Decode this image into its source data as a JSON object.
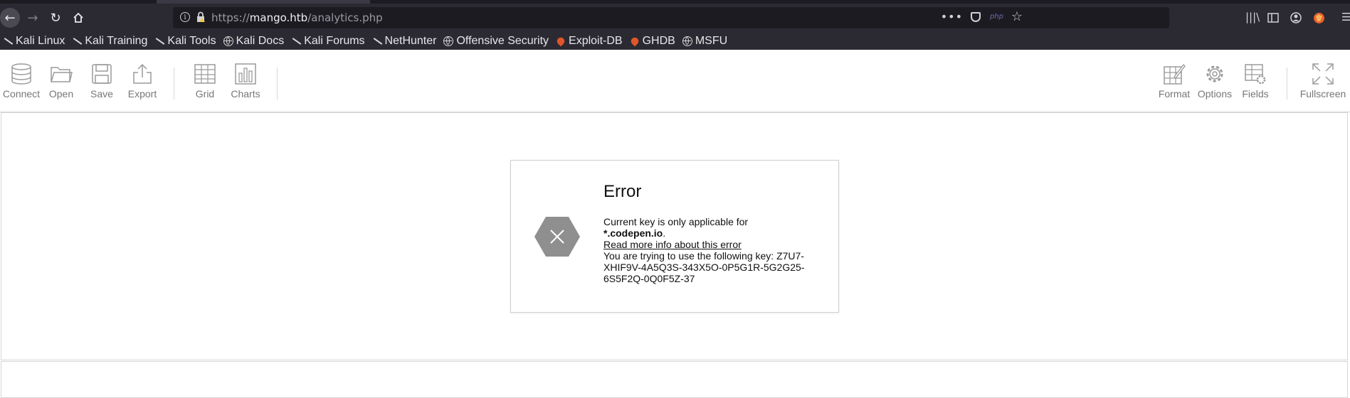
{
  "browser": {
    "url_scheme": "https://",
    "url_host": "mango.htb",
    "url_path": "/analytics.php",
    "url_badge": "php"
  },
  "bookmarks": [
    {
      "label": "Kali Linux",
      "icon": "kali-icon"
    },
    {
      "label": "Kali Training",
      "icon": "kali-icon"
    },
    {
      "label": "Kali Tools",
      "icon": "kali-icon"
    },
    {
      "label": "Kali Docs",
      "icon": "globe-icon"
    },
    {
      "label": "Kali Forums",
      "icon": "kali-icon"
    },
    {
      "label": "NetHunter",
      "icon": "kali-icon"
    },
    {
      "label": "Offensive Security",
      "icon": "globe-icon"
    },
    {
      "label": "Exploit-DB",
      "icon": "exploitdb-icon"
    },
    {
      "label": "GHDB",
      "icon": "exploitdb-icon"
    },
    {
      "label": "MSFU",
      "icon": "globe-icon"
    }
  ],
  "toolbar": {
    "connect": "Connect",
    "open": "Open",
    "save": "Save",
    "export": "Export",
    "grid": "Grid",
    "charts": "Charts",
    "format": "Format",
    "options": "Options",
    "fields": "Fields",
    "fullscreen": "Fullscreen"
  },
  "dialog": {
    "title": "Error",
    "line1": "Current key is only applicable for",
    "domain": "*.codepen.io",
    "period": ".",
    "link": "Read more info about this error",
    "key_text": "You are trying to use the following key: Z7U7-XHIF9V-4A5Q3S-343X5O-0P5G1R-5G2G25-6S5F2Q-0Q0F5Z-37"
  },
  "colors": {
    "browser_bg": "#2b2a33",
    "urlbar_bg": "#1c1b22",
    "toolbar_icon": "#9a9a9a",
    "error_hex": "#8f8f8f"
  }
}
